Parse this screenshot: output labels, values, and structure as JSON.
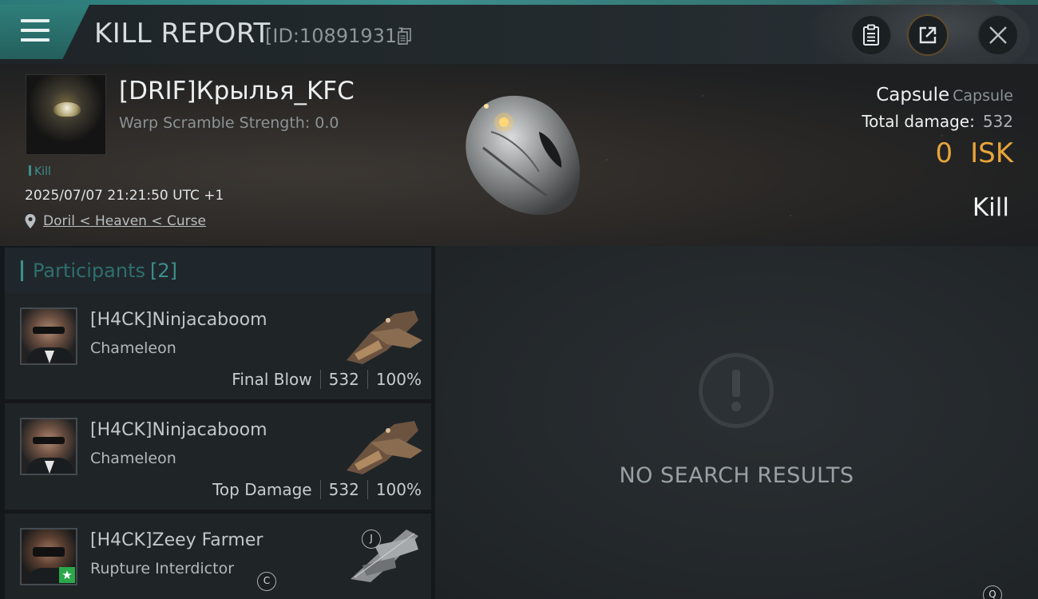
{
  "header": {
    "title": "KILL REPORT",
    "report_id": "[ID:10891931]",
    "buttons": [
      "clipboard-icon",
      "share-icon",
      "close-icon"
    ]
  },
  "victim": {
    "name": "[DRIF]Крылья_KFC",
    "warp_scramble": "Warp Scramble Strength: 0.0",
    "tag": "Kill",
    "timestamp": "2025/07/07 21:21:50 UTC +1",
    "location": "Doril < Heaven < Curse",
    "ship_name": "Capsule",
    "ship_type": "Capsule",
    "total_damage_label": "Total damage:",
    "total_damage": "532",
    "isk_value": "0",
    "isk_unit": "ISK",
    "result": "Kill"
  },
  "participants": {
    "title": "Participants",
    "count": "[2]",
    "rows": [
      {
        "name": "[H4CK]Ninjacaboom",
        "ship": "Chameleon",
        "role": "Final Blow",
        "damage": "532",
        "percent": "100%"
      },
      {
        "name": "[H4CK]Ninjacaboom",
        "ship": "Chameleon",
        "role": "Top Damage",
        "damage": "532",
        "percent": "100%"
      },
      {
        "name": "[H4CK]Zeey Farmer",
        "ship": "Rupture Interdictor",
        "badge_ship": "C",
        "badge_thumb": "J"
      }
    ]
  },
  "empty_state": {
    "text": "NO SEARCH RESULTS"
  },
  "corner_badge": "Q",
  "colors": {
    "accent": "#3d8f8c",
    "isk": "#e8a53a"
  }
}
